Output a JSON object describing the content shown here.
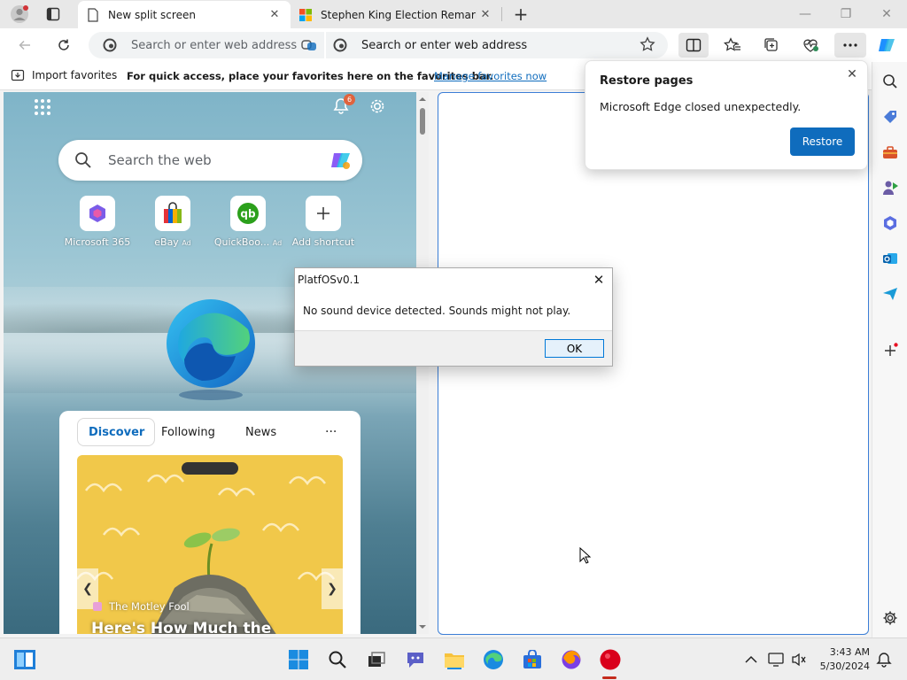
{
  "browser": {
    "tabs": [
      {
        "title": "New split screen",
        "active": true
      },
      {
        "title": "Stephen King Election Remark Ta",
        "active": false
      }
    ],
    "address_left": {
      "placeholder": "Search or enter web address"
    },
    "address_right": {
      "placeholder": "Search or enter web address"
    },
    "favorites_bar": {
      "import_label": "Import favorites",
      "message": "For quick access, place your favorites here on the favorites bar.",
      "link": "Manage favorites now"
    },
    "icons": {
      "profile": "profile-icon",
      "tab_actions": "tab-actions-icon",
      "new_tab": "plus-icon",
      "back": "arrow-left-icon",
      "refresh": "refresh-icon",
      "favorite": "star-icon",
      "split": "split-screen-icon",
      "favorites": "favorites-icon",
      "collections": "collections-icon",
      "health": "browser-essentials-icon",
      "more": "ellipsis-icon",
      "copilot": "copilot-icon"
    },
    "colors": {
      "accent": "#0f6cbd",
      "split_border": "#3b7ed6"
    }
  },
  "ntp": {
    "notification_count": "6",
    "search_placeholder": "Search the web",
    "shortcuts": [
      {
        "label": "Microsoft 365",
        "ad": ""
      },
      {
        "label": "eBay",
        "ad": "Ad"
      },
      {
        "label": "QuickBoo...",
        "ad": "Ad"
      },
      {
        "label": "Add shortcut",
        "ad": ""
      }
    ],
    "feed_tabs": {
      "discover": "Discover",
      "following": "Following",
      "news": "News",
      "more": "···"
    },
    "card": {
      "source": "The Motley Fool",
      "headline": "Here's How Much the"
    }
  },
  "restore_popup": {
    "title": "Restore pages",
    "message": "Microsoft Edge closed unexpectedly.",
    "button": "Restore"
  },
  "dialog": {
    "title": "PlatfOSv0.1",
    "message": "No sound device detected. Sounds might not play.",
    "ok": "OK"
  },
  "taskbar": {
    "time": "3:43 AM",
    "date": "5/30/2024"
  }
}
